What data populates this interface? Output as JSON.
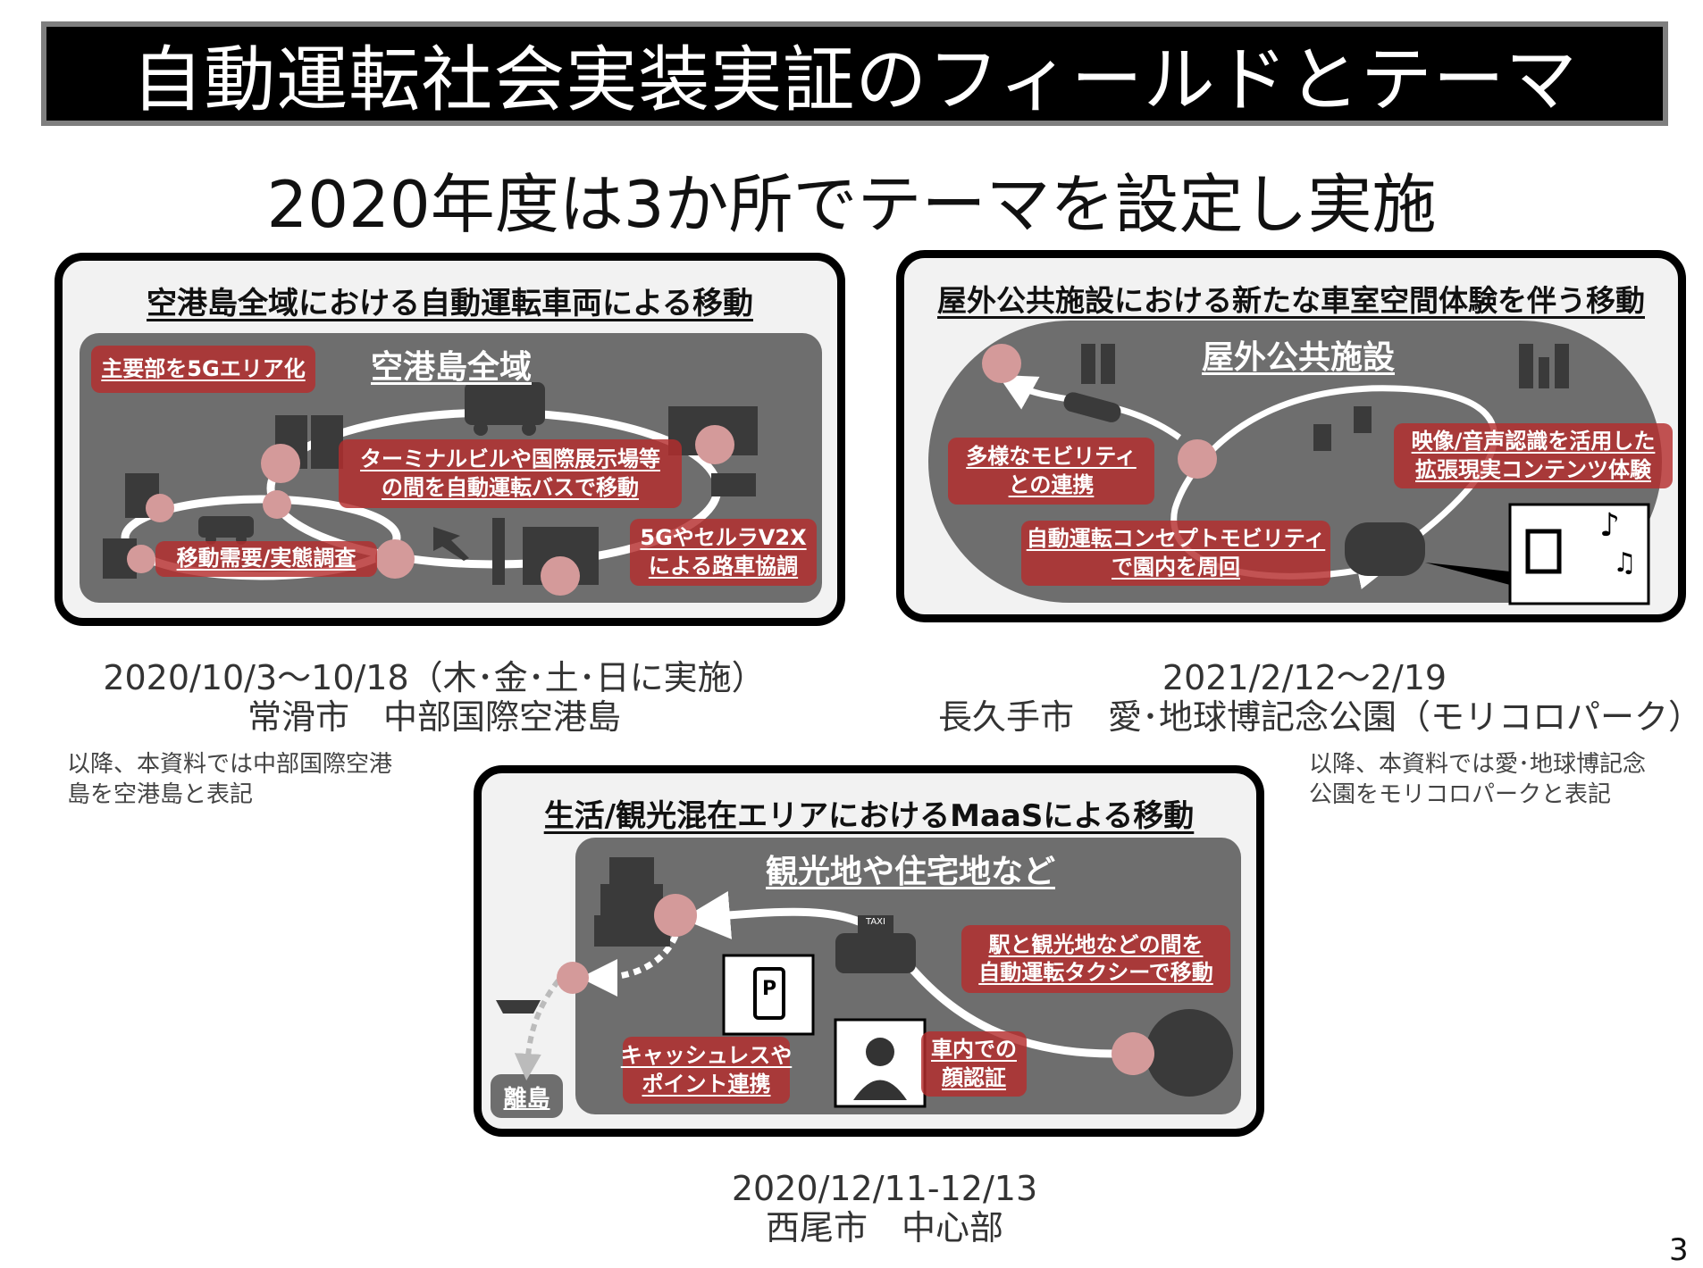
{
  "header": {
    "title": "自動運転社会実装実証のフィールドとテーマ",
    "subtitle": "2020年度は3か所でテーマを設定し実施"
  },
  "panels": [
    {
      "title": "空港島全域における自動運転車両による移動",
      "area_label": "空港島全域",
      "callouts": [
        "主要部を5Gエリア化",
        "ターミナルビルや国際展示場等",
        "の間を自動運転バスで移動",
        "移動需要/実態調査",
        "5GやセルラV2X",
        "による路車協調"
      ],
      "date": "2020/10/3～10/18（木･金･土･日に実施）",
      "place": "常滑市　中部国際空港島",
      "note": [
        "以降、本資料では中部国際空港",
        "島を空港島と表記"
      ]
    },
    {
      "title": "屋外公共施設における新たな車室空間体験を伴う移動",
      "area_label": "屋外公共施設",
      "callouts": [
        "多様なモビリティ",
        "との連携",
        "映像/音声認識を活用した",
        "拡張現実コンテンツ体験",
        "自動運転コンセプトモビリティ",
        "で園内を周回"
      ],
      "date": "2021/2/12～2/19",
      "place": "長久手市　愛･地球博記念公園（モリコロパーク）",
      "note": [
        "以降、本資料では愛･地球博記念",
        "公園をモリコロパークと表記"
      ]
    },
    {
      "title": "生活/観光混在エリアにおけるMaaSによる移動",
      "area_label": "観光地や住宅地など",
      "callouts": [
        "駅と観光地などの間を",
        "自動運転タクシーで移動",
        "キャッシュレスや",
        "ポイント連携",
        "車内での",
        "顔認証"
      ],
      "island_label": "離島",
      "taxi_sign": "TAXI",
      "parking_sign": "P",
      "date": "2020/12/11-12/13",
      "place": "西尾市　中心部"
    }
  ],
  "page_number": "3",
  "colors": {
    "accent_red": "#b42d2d",
    "stop_pink": "#d49a9a",
    "area_gray": "#6e6e6e"
  }
}
